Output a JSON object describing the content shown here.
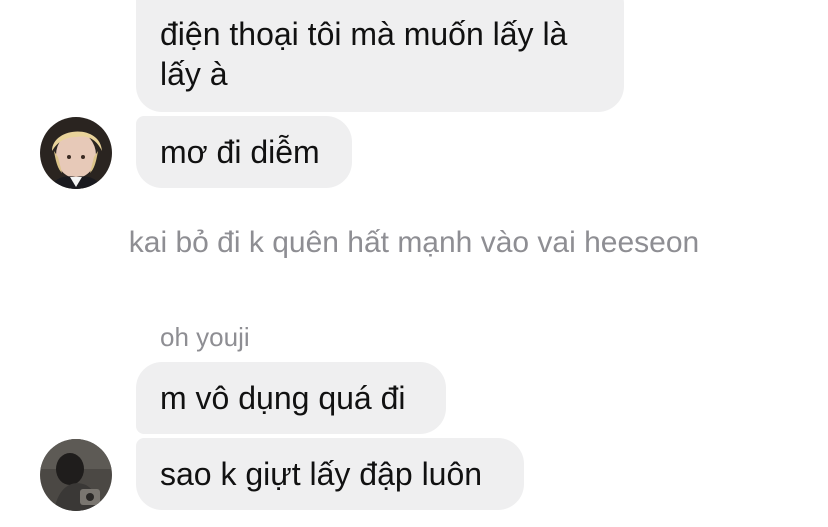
{
  "messages": [
    {
      "text": "điện thoại tôi mà muốn lấy là lấy à"
    },
    {
      "text": "mơ đi diễm"
    },
    {
      "text": "m vô dụng quá đi"
    },
    {
      "text": "sao k giựt lấy đập luôn"
    }
  ],
  "system_note": "kai bỏ đi k quên hất mạnh vào vai heeseon",
  "sender_name": "oh youji",
  "colors": {
    "bubble_bg": "#efeff0",
    "meta_text": "#8e8e93",
    "text": "#111111"
  }
}
